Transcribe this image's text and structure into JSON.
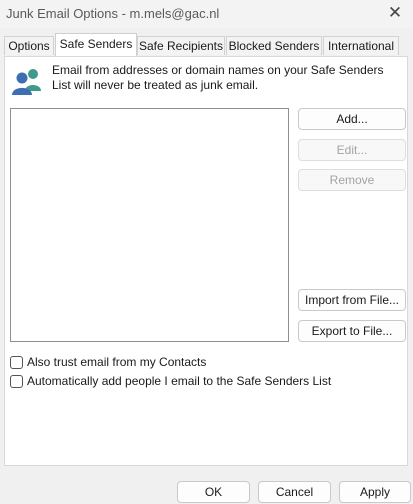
{
  "window": {
    "title": "Junk Email Options - m.mels@gac.nl",
    "close_symbol": "✕"
  },
  "tabs": [
    {
      "label": "Options"
    },
    {
      "label": "Safe Senders",
      "active": true
    },
    {
      "label": "Safe Recipients"
    },
    {
      "label": "Blocked Senders"
    },
    {
      "label": "International"
    }
  ],
  "safe_senders": {
    "icon": "people-icon",
    "description": "Email from addresses or domain names on your Safe Senders List will never be treated as junk email.",
    "list_items": [],
    "buttons": {
      "add": "Add...",
      "edit": "Edit...",
      "remove": "Remove",
      "import": "Import from File...",
      "export": "Export to File..."
    },
    "checkboxes": {
      "trust_contacts": {
        "label": "Also trust email from my Contacts",
        "checked": false
      },
      "auto_add": {
        "label": "Automatically add people I email to the Safe Senders List",
        "checked": false
      }
    }
  },
  "footer": {
    "ok": "OK",
    "cancel": "Cancel",
    "apply": "Apply"
  },
  "colors": {
    "dialog_bg": "#f0f0f0",
    "panel_bg": "#ffffff",
    "icon_blue": "#3d6db3",
    "icon_teal": "#3f9a8c"
  }
}
